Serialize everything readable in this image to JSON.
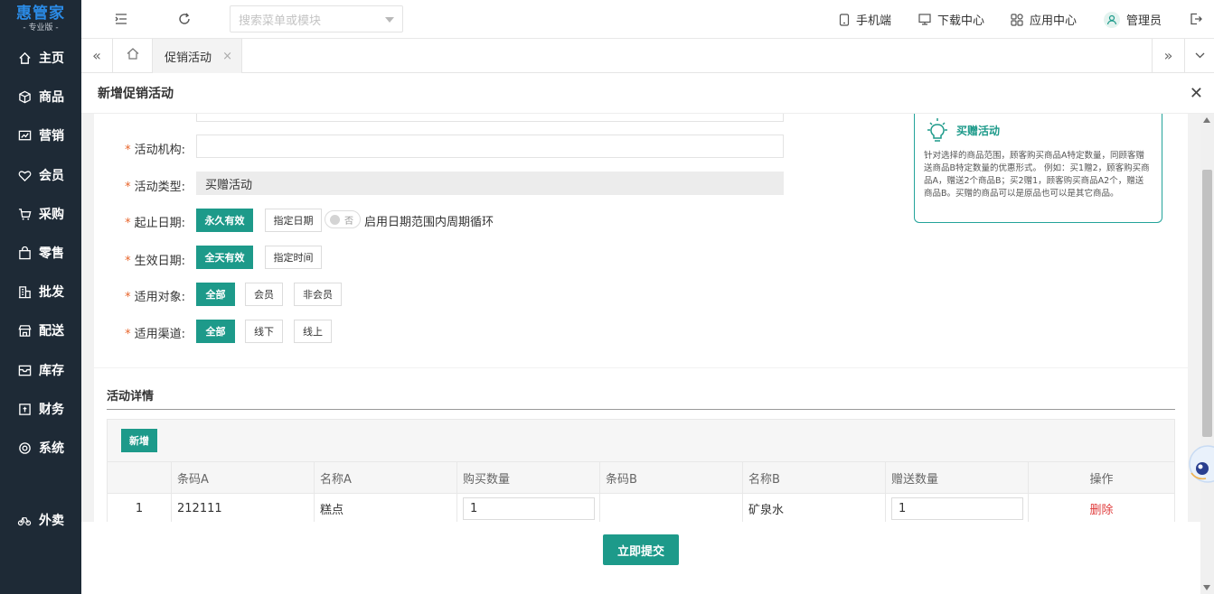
{
  "app": {
    "logo": "惠管家",
    "edition": "- 专业版 -"
  },
  "sidebar": {
    "items": [
      {
        "label": "主页",
        "icon": "home-icon"
      },
      {
        "label": "商品",
        "icon": "cube-icon"
      },
      {
        "label": "营销",
        "icon": "chart-icon"
      },
      {
        "label": "会员",
        "icon": "heart-icon"
      },
      {
        "label": "采购",
        "icon": "cart-icon"
      },
      {
        "label": "零售",
        "icon": "bag-icon"
      },
      {
        "label": "批发",
        "icon": "building-icon"
      },
      {
        "label": "配送",
        "icon": "store-icon"
      },
      {
        "label": "库存",
        "icon": "inbox-icon"
      },
      {
        "label": "财务",
        "icon": "finance-icon"
      },
      {
        "label": "系统",
        "icon": "settings-icon"
      },
      {
        "label": "外卖",
        "icon": "bike-icon"
      }
    ]
  },
  "topbar": {
    "search_placeholder": "搜索菜单或模块",
    "mobile": "手机端",
    "download": "下载中心",
    "apps": "应用中心",
    "user": "管理员"
  },
  "tabs": {
    "active": "促销活动"
  },
  "panel": {
    "title": "新增促销活动"
  },
  "form": {
    "org_label": "活动机构:",
    "type_label": "活动类型:",
    "type_value": "买赠活动",
    "date_label": "起止日期:",
    "date_opt_forever": "永久有效",
    "date_opt_specify": "指定日期",
    "cycle_toggle_text": "否",
    "cycle_label": "启用日期范围内周期循环",
    "effect_label": "生效日期:",
    "effect_opt_allday": "全天有效",
    "effect_opt_time": "指定时间",
    "target_label": "适用对象:",
    "target_all": "全部",
    "target_member": "会员",
    "target_nonmember": "非会员",
    "channel_label": "适用渠道:",
    "channel_all": "全部",
    "channel_offline": "线下",
    "channel_online": "线上"
  },
  "tip": {
    "title": "买赠活动",
    "body": "针对选择的商品范围，顾客购买商品A特定数量，同顾客赠送商品B特定数量的优惠形式。 例如：买1赠2，顾客购买商品A，赠送2个商品B；买2赠1，顾客购买商品A2个，赠送商品B。买赠的商品可以是原品也可以是其它商品。"
  },
  "details": {
    "title": "活动详情",
    "add_button": "新增",
    "columns": [
      "条码A",
      "名称A",
      "购买数量",
      "条码B",
      "名称B",
      "赠送数量",
      "操作"
    ],
    "rows": [
      {
        "index": "1",
        "barcode_a": "212111",
        "name_a": "糕点",
        "buy_qty": "1",
        "barcode_b": "",
        "name_b": "矿泉水",
        "gift_qty": "1",
        "action": "删除"
      }
    ]
  },
  "footer": {
    "submit": "立即提交"
  },
  "colors": {
    "primary": "#1d9a8a",
    "sidebar": "#1e2a36",
    "danger": "#e03c3c",
    "required": "#e8652c"
  }
}
